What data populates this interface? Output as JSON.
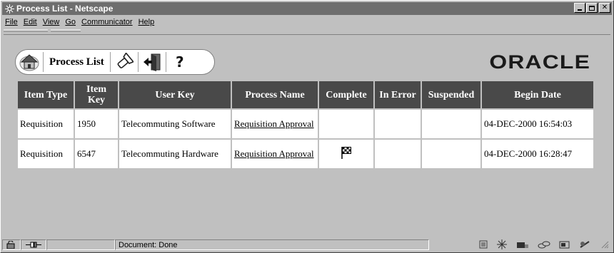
{
  "window": {
    "title": "Process List - Netscape"
  },
  "menu": [
    "File",
    "Edit",
    "View",
    "Go",
    "Communicator",
    "Help"
  ],
  "toolbar": {
    "label": "Process List"
  },
  "brand": "ORACLE",
  "table": {
    "headers": [
      "Item Type",
      "Item Key",
      "User Key",
      "Process Name",
      "Complete",
      "In Error",
      "Suspended",
      "Begin Date"
    ],
    "rows": [
      {
        "item_type": "Requisition",
        "item_key": "1950",
        "user_key": "Telecommuting Software",
        "process_name": "Requisition Approval",
        "complete": "",
        "begin_date": "04-DEC-2000 16:54:03"
      },
      {
        "item_type": "Requisition",
        "item_key": "6547",
        "user_key": "Telecommuting Hardware",
        "process_name": "Requisition Approval",
        "complete": "flag",
        "begin_date": "04-DEC-2000 16:28:47"
      }
    ]
  },
  "status": {
    "text": "Document: Done"
  }
}
